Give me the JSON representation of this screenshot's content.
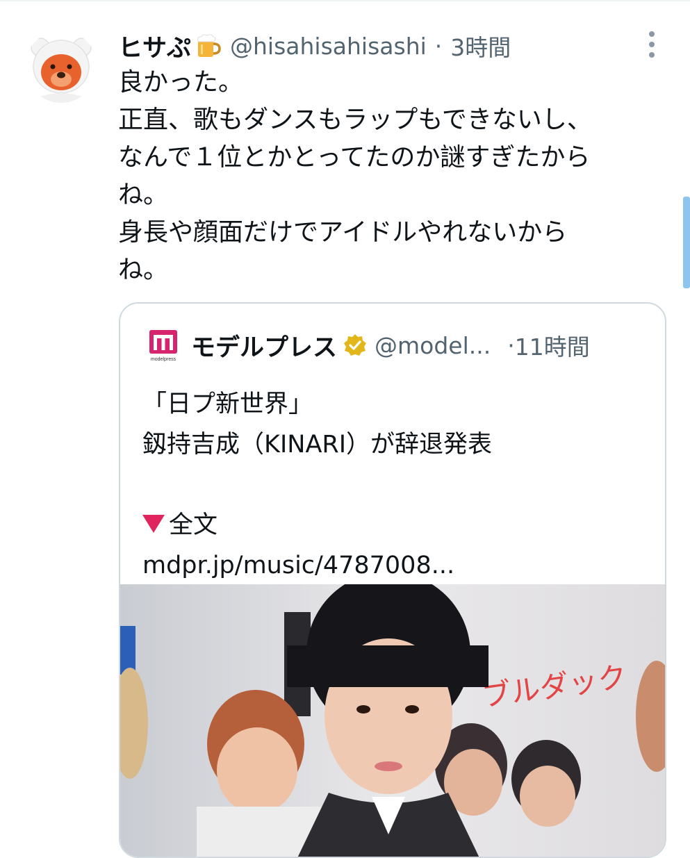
{
  "tweet": {
    "author_name": "ヒサぷ",
    "author_emoji": "beer-mug-icon",
    "handle": "@hisahisahisashi",
    "separator": "·",
    "time": "3時間",
    "lines": [
      "良かった。",
      "正直、歌もダンスもラップもできないし、",
      "なんで１位とかとってたのか謎すぎたから",
      "ね。",
      "身長や顔面だけでアイドルやれないから",
      "ね。"
    ]
  },
  "quote": {
    "author_name": "モデルプレス",
    "logo_text": "modelpress",
    "verified_icon": "verified-badge-icon",
    "handle": "@model...",
    "separator": "·",
    "time": "11時間",
    "lines": [
      "「日プ新世界」",
      "釼持吉成（KINARI）が辞退発表",
      "",
      "全文",
      "mdpr.jp/music/4787008..."
    ],
    "media_sign_text": "ブルダック"
  },
  "colors": {
    "text_primary": "#0f1419",
    "text_secondary": "#536471",
    "card_border": "#cfd9de",
    "verified_gold": "#e2b719",
    "logo_magenta": "#d6246e"
  }
}
